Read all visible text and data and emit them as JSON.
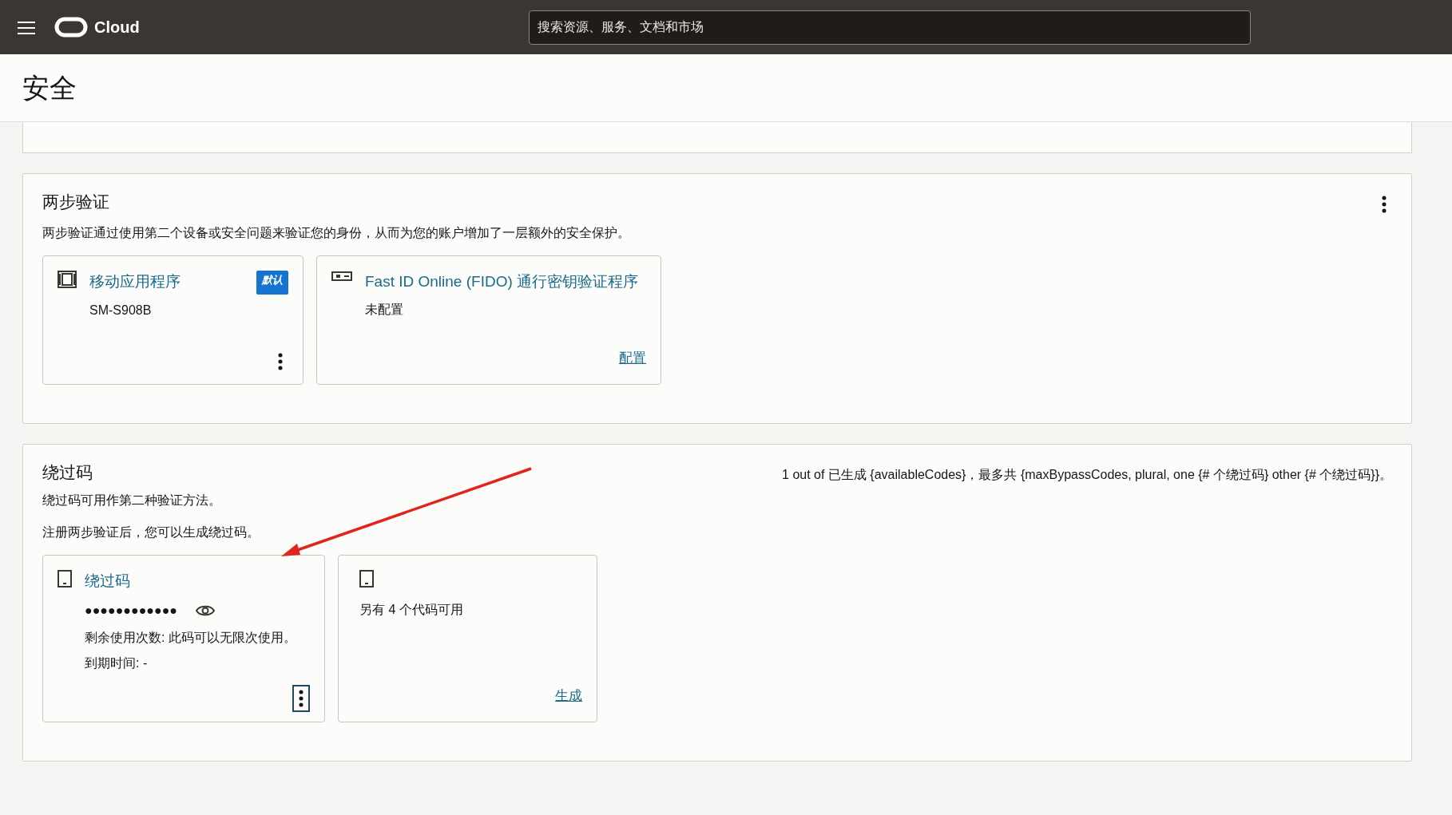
{
  "header": {
    "title": "Cloud",
    "search": {
      "placeholder": "搜索资源、服务、文档和市场"
    }
  },
  "page_title": "安全",
  "sections": [
    {
      "title": "两步验证",
      "menu": true,
      "paragraphs": [
        "两步验证通过使用第二个设备或安全问题来验证您的身份，从而为您的账户增加了一层额外的安全保护。"
      ],
      "cards": [
        {
          "kind": "mobile_app",
          "title": "移动应用程序",
          "badge": "默认",
          "lines": [
            "SM-S908B"
          ],
          "action": {
            "kind": "menu",
            "focused": false
          }
        },
        {
          "kind": "fido",
          "title": "Fast ID Online (FIDO) 通行密钥验证程序",
          "lines": [
            "未配置"
          ],
          "action": {
            "kind": "link",
            "label": "配置"
          }
        }
      ]
    },
    {
      "title": "绕过码",
      "summary": "1 out of 已生成 {availableCodes}，最多共 {maxBypassCodes, plural, one {# 个绕过码} other {# 个绕过码}}。",
      "paragraphs": [
        "绕过码可用作第二种验证方法。",
        "注册两步验证后，您可以生成绕过码。"
      ],
      "cards": [
        {
          "kind": "bypass_code",
          "title": "绕过码",
          "masked": "●●●●●●●●●●●●",
          "lines": [
            "剩余使用次数: 此码可以无限次使用。",
            "到期时间: -"
          ],
          "action": {
            "kind": "menu",
            "focused": true
          }
        },
        {
          "kind": "bypass_more",
          "lines": [
            "另有 4 个代码可用"
          ],
          "action": {
            "kind": "link",
            "label": "生成"
          }
        }
      ]
    }
  ]
}
